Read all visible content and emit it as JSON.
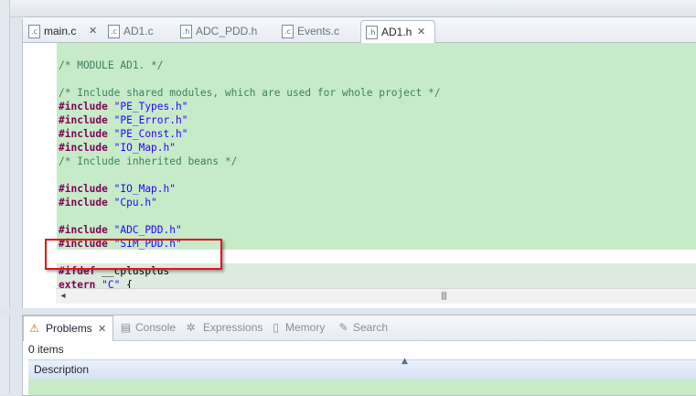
{
  "editor": {
    "tabs": [
      {
        "name": "main.c",
        "icon": "c-file-icon",
        "active": false,
        "closable": true
      },
      {
        "name": "AD1.c",
        "icon": "c-file-icon",
        "active": false
      },
      {
        "name": "ADC_PDD.h",
        "icon": "h-file-icon",
        "active": false
      },
      {
        "name": "Events.c",
        "icon": "c-file-icon",
        "active": false
      },
      {
        "name": "AD1.h",
        "icon": "h-file-icon",
        "active": true,
        "closable": true
      }
    ],
    "code_lines": [
      "/* MODULE AD1. */",
      "",
      "/* Include shared modules, which are used for whole project */",
      "#include \"PE_Types.h\"",
      "#include \"PE_Error.h\"",
      "#include \"PE_Const.h\"",
      "#include \"IO_Map.h\"",
      "/* Include inherited beans */",
      "",
      "#include \"IO_Map.h\"",
      "#include \"Cpu.h\"",
      "",
      "#include \"ADC_PDD.h\"",
      "#include \"SIM_PDD.h\"",
      "",
      "#ifdef __cplusplus",
      "extern \"C\" {"
    ],
    "highlight_color": "#e2141b",
    "code_background": "#c7ebc9"
  },
  "problems": {
    "tabs": [
      {
        "label": "Problems",
        "icon": "problems-icon",
        "active": true
      },
      {
        "label": "Console",
        "icon": "console-icon",
        "active": false
      },
      {
        "label": "Expressions",
        "icon": "expressions-icon",
        "active": false
      },
      {
        "label": "Memory",
        "icon": "memory-icon",
        "active": false
      },
      {
        "label": "Search",
        "icon": "search-icon",
        "active": false
      }
    ],
    "items_count": "0 items",
    "column_header": "Description"
  }
}
